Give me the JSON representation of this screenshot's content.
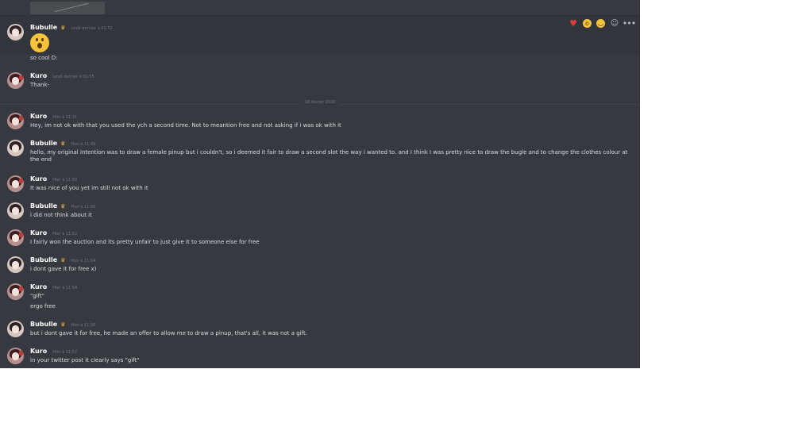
{
  "divider_date": "18 février 2020",
  "messages": [
    {
      "user": "Bubulle",
      "crown": true,
      "time": "lundi dernier à 01:52",
      "lines": [
        "so cool D:"
      ],
      "emoji": "open-mouth-emoji"
    },
    {
      "user": "Kuro",
      "crown": false,
      "time": "lundi dernier à 01:55",
      "lines": [
        "Thank-"
      ]
    },
    {
      "user": "Kuro",
      "crown": false,
      "time": "Hier à 11:31",
      "lines": [
        "Hey, im not ok with that you used the ych a second time. Not to meantion free and not asking if i was ok with it"
      ]
    },
    {
      "user": "Bubulle",
      "crown": true,
      "time": "Hier à 11:49",
      "lines": [
        "hello, my original intention was to draw a female pinup but i couldn't, so i deemed it fair to draw a second slot the way i wanted to. and I think I was pretty nice to draw the bugle and to change the clothes colour at the end"
      ]
    },
    {
      "user": "Kuro",
      "crown": false,
      "time": "Hier à 11:50",
      "lines": [
        "It was nice of you yet im still not ok with it"
      ]
    },
    {
      "user": "Bubulle",
      "crown": true,
      "time": "Hier à 11:50",
      "lines": [
        "i did not think about it"
      ]
    },
    {
      "user": "Kuro",
      "crown": false,
      "time": "Hier à 11:52",
      "lines": [
        "I fairly won the auction and its pretty unfair to just give it to someone else for free"
      ]
    },
    {
      "user": "Bubulle",
      "crown": true,
      "time": "Hier à 11:54",
      "lines": [
        "i dont gave it for free x)"
      ]
    },
    {
      "user": "Kuro",
      "crown": false,
      "time": "Hier à 11:54",
      "lines": [
        "\"gift\"",
        "ergo free"
      ]
    },
    {
      "user": "Bubulle",
      "crown": true,
      "time": "Hier à 11:56",
      "lines": [
        "but i dont gave it for free, he made an offer to allow me to draw a pinup, that's all, it was not a gift."
      ]
    },
    {
      "user": "Kuro",
      "crown": false,
      "time": "Hier à 11:57",
      "lines": [
        "in your twitter post it clearly says \"gift\""
      ]
    }
  ],
  "reaction_bar": [
    "heart-icon",
    "open-mouth-emoji-icon",
    "smiley-emoji-icon",
    "add-reaction-icon",
    "more-icon"
  ],
  "colors": {
    "background": "#36393f",
    "crown": "#f0b232",
    "timestamp": "#72767d",
    "text": "#dcddde"
  }
}
